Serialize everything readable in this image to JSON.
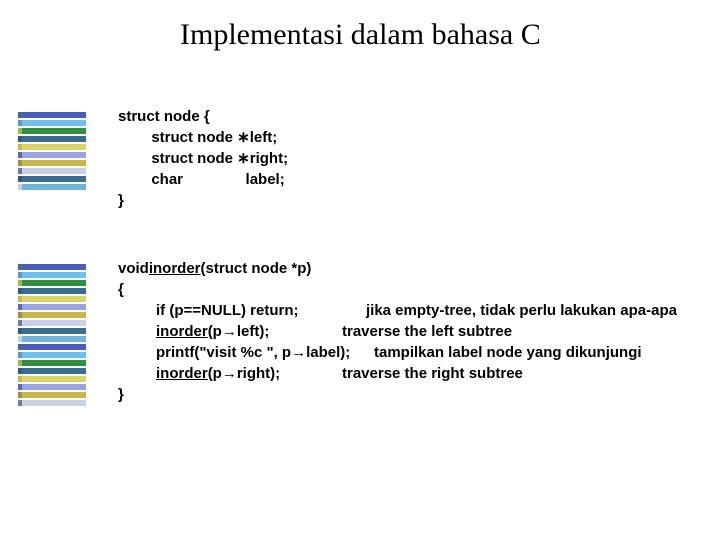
{
  "title": "Implementasi dalam bahasa C",
  "stripes": {
    "colors_a": [
      "#4a5dbf",
      "#6ec0f0",
      "#2e8f3f",
      "#3a6c8f",
      "#d9d46a",
      "#9aa4e0",
      "#c9b74a",
      "#c9cfe6",
      "#3a6c8f",
      "#6fb5d9"
    ],
    "colors_b": [
      "#3a6c8f",
      "#5aa0c0",
      "#8fbf4a",
      "#2e5c7a",
      "#c9b74a",
      "#5a6ac0",
      "#a08f3a",
      "#6f7aa0",
      "#2e5c7a",
      "#c9cfe6"
    ]
  },
  "struct": {
    "l1": "struct node {",
    "l2": "        struct node ∗left;",
    "l3": "        struct node ∗right;",
    "l4": "        char               label;",
    "l5": "}"
  },
  "fn": {
    "ret": "void ",
    "name": "inorder",
    "sig": "(struct node *p)",
    "open": "{",
    "if_line": "if (p==NULL)  return;",
    "if_cmt": "jika empty-tree, tidak perlu lakukan apa-apa",
    "left_call_a": "inorder",
    "left_call_b": "(p→left);",
    "left_cmt": "traverse the left subtree",
    "printf": "printf(\"visit %c \", p→label);",
    "printf_cmt": "tampilkan label node yang dikunjungi",
    "right_call_a": "inorder",
    "right_call_b": "(p→right);",
    "right_cmt": "traverse the right subtree",
    "close": "}"
  }
}
